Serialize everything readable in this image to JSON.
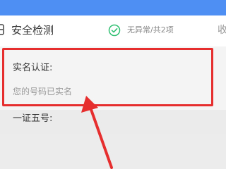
{
  "header": {
    "title": "安全检测",
    "status_text": "无异常/共2项",
    "collapse_text": "收"
  },
  "realname": {
    "label": "实名认证:",
    "status": "您的号码已实名"
  },
  "oneid": {
    "label": "一证五号:"
  },
  "colors": {
    "accent_blue": "#4d8ff3",
    "check_green": "#2fbf71",
    "highlight_red": "#e62e2e"
  }
}
